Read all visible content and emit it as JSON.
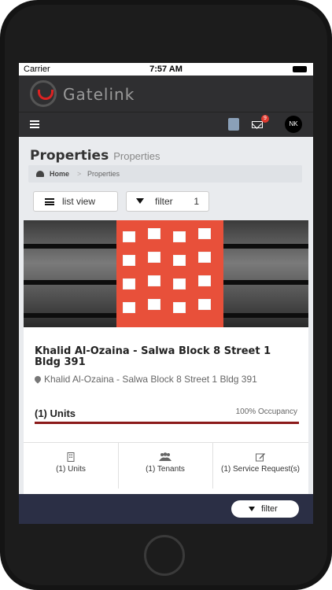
{
  "status_bar": {
    "carrier": "Carrier",
    "time": "7:57 AM"
  },
  "app": {
    "logo_text": "Gatelink",
    "mail_badge_count": "9",
    "avatar_initials": "NK"
  },
  "page": {
    "title": "Properties",
    "subtitle": "Properties"
  },
  "breadcrumb": {
    "home": "Home",
    "current": "Properties"
  },
  "toolbar": {
    "list_view_label": "list view",
    "filter_label": "filter",
    "filter_count": "1"
  },
  "property": {
    "title": "Khalid Al-Ozaina - Salwa Block 8 Street 1 Bldg 391",
    "address": "Khalid Al-Ozaina - Salwa Block 8 Street 1 Bldg 391",
    "units_label": "(1) Units",
    "occupancy_text": "100% Occupancy",
    "occupancy_fraction": 1.0,
    "stats": [
      {
        "icon": "building-icon",
        "label": "(1) Units"
      },
      {
        "icon": "users-icon",
        "label": "(1) Tenants"
      },
      {
        "icon": "edit-icon",
        "label": "(1) Service Request(s)"
      }
    ]
  },
  "bottom_bar": {
    "filter_label": "filter"
  },
  "colors": {
    "header": "#2f2f31",
    "bottom_bar": "#2b2f45",
    "accent": "#8b1a1a",
    "badge": "#e03a2f"
  }
}
